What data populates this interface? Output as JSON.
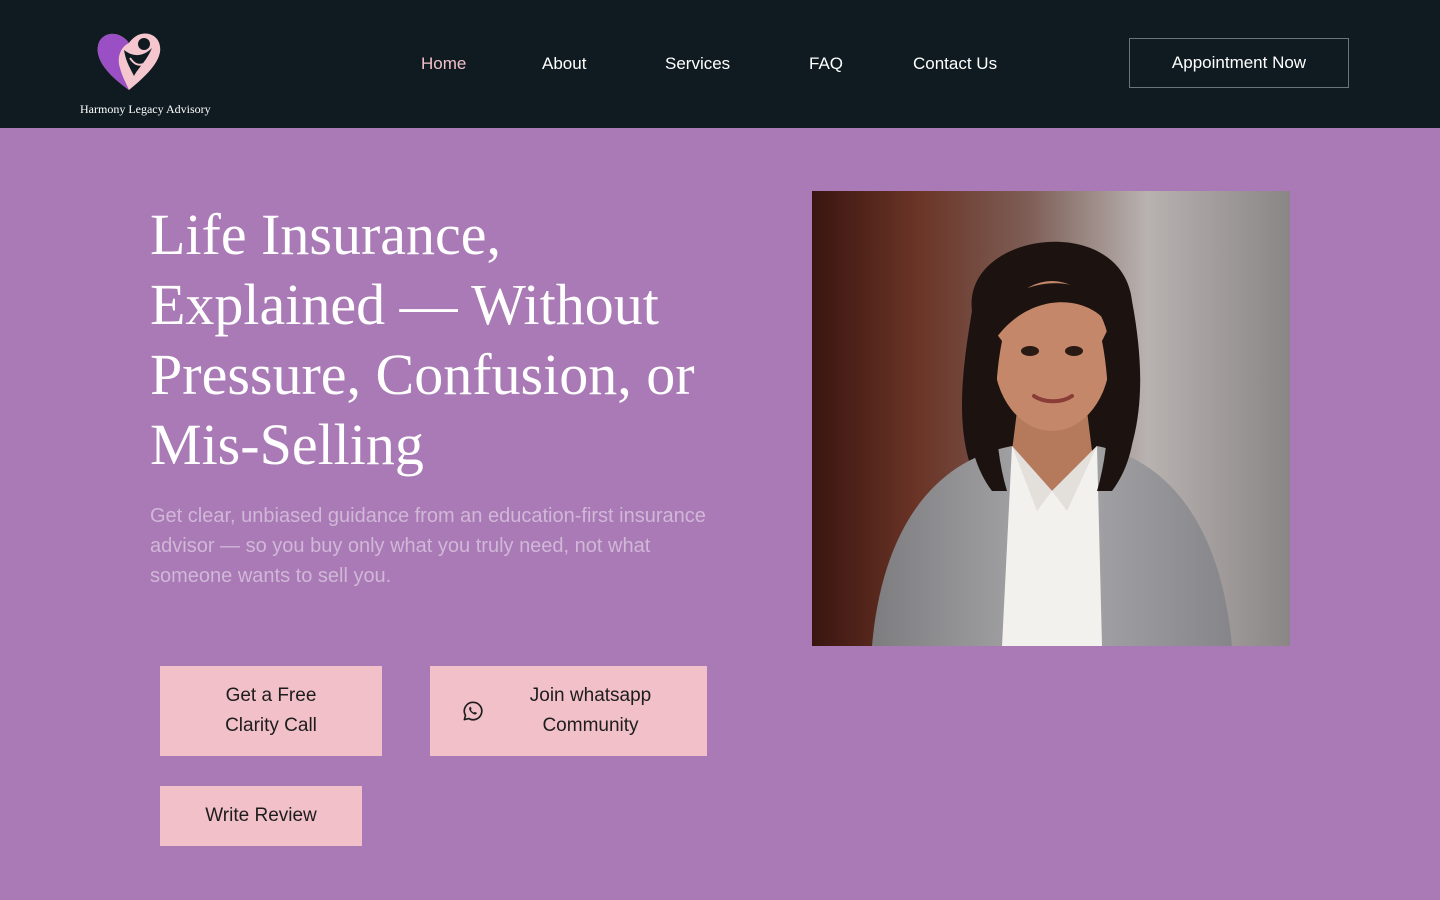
{
  "brand": {
    "name": "Harmony Legacy Advisory",
    "logo_icon": "heart-figure-logo-icon",
    "colors": {
      "header_bg": "#0f1b21",
      "page_bg": "#a97ab5",
      "accent_pink": "#f2c0c8",
      "logo_purple": "#9b4fc4"
    }
  },
  "nav": {
    "items": [
      {
        "label": "Home",
        "active": true
      },
      {
        "label": "About",
        "active": false
      },
      {
        "label": "Services",
        "active": false
      },
      {
        "label": "FAQ",
        "active": false
      },
      {
        "label": "Contact Us",
        "active": false
      }
    ],
    "cta_label": "Appointment Now"
  },
  "hero": {
    "title": "Life Insurance, Explained — Without Pressure, Confusion, or Mis-Selling",
    "subtitle": "Get clear, unbiased guidance from an education-first insurance advisor — so you buy only what you truly need, not what someone wants to sell you.",
    "buttons": {
      "clarity_call": "Get a Free Clarity Call",
      "whatsapp": "Join whatsapp Community",
      "whatsapp_icon": "whatsapp-icon",
      "review": "Write Review"
    },
    "portrait_alt": "advisor-portrait"
  }
}
